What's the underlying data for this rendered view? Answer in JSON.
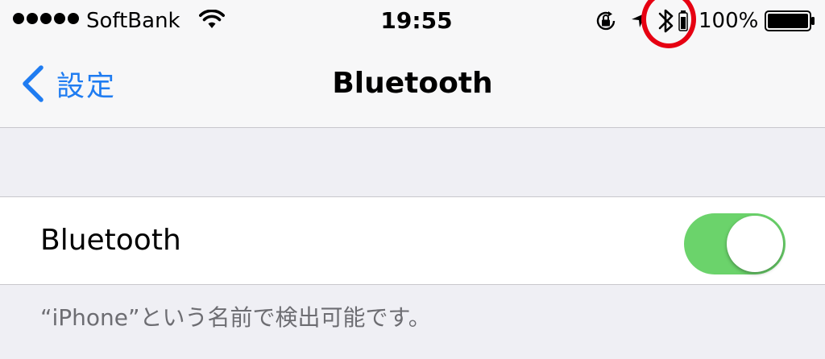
{
  "status_bar": {
    "carrier": "SoftBank",
    "time": "19:55",
    "battery_percent": "100%",
    "icons": [
      "signal-dots",
      "wifi-icon",
      "rotation-lock-icon",
      "location-arrow-icon",
      "bluetooth-icon",
      "bluetooth-device-battery-icon",
      "battery-icon"
    ],
    "highlight_color": "#e60012"
  },
  "nav": {
    "back_label": "設定",
    "title": "Bluetooth",
    "accent_color": "#1f7cf1"
  },
  "settings": {
    "bluetooth_label": "Bluetooth",
    "bluetooth_enabled": true,
    "toggle_color": "#6bd36b",
    "discoverable_note": "“iPhone”という名前で検出可能です。"
  }
}
